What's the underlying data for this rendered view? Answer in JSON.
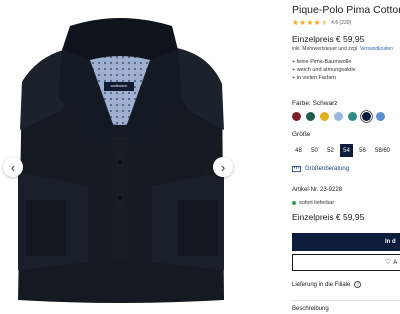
{
  "gallery": {
    "brand_tag": "walbusch",
    "prev_icon": "chevron-left-icon",
    "next_icon": "chevron-right-icon",
    "prev_glyph": "‹",
    "next_glyph": "›"
  },
  "product": {
    "title": "Pique-Polo Pima Cotton",
    "rating_value": 4.6,
    "rating_max": 5,
    "rating_text": "4.6 (220)",
    "price": "Einzelpreis € 59,95",
    "tax_text": "inkl. Mehrwertsteuer und zzgl.",
    "shipping_link": "Versandkosten",
    "features": [
      "+ feine Pima-Baumwolle",
      "+ weich und atmungsaktiv",
      "+ in vielen Farben"
    ],
    "color_label": "Farbe: Schwarz",
    "swatches": [
      "#7a1f2b",
      "#1f5a4a",
      "#e0b21a",
      "#9db6de",
      "#2f8b86",
      "#0d1e3c",
      "#5a90d2"
    ],
    "selected_swatch": 5,
    "size_label": "Größe",
    "sizes": [
      "48",
      "50",
      "52",
      "54",
      "56",
      "58/60"
    ],
    "selected_size": "54",
    "size_advice": "Größenberatung",
    "article_number": "Artikel-Nr. 23-9228",
    "availability": "sofort lieferbar",
    "price_repeat": "Einzelpreis € 59,95",
    "cart_button": "In d",
    "wishlist_glyph": "♡",
    "wishlist_text": "A",
    "store_delivery": "Lieferung in die Filiale",
    "info_glyph": "i",
    "description_heading": "Beschreibung"
  },
  "colors": {
    "star": "#f2a81d",
    "primary_button": "#0d1e3c",
    "link": "#2b66b5",
    "in_stock": "#2ea44f"
  }
}
